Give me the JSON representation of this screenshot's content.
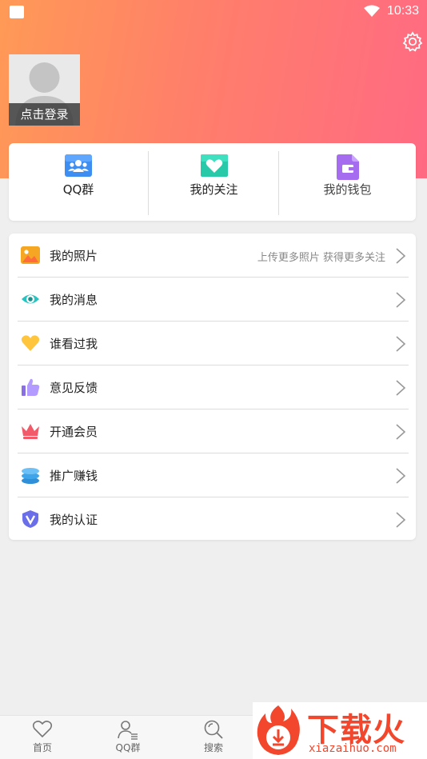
{
  "status_bar": {
    "time": "10:33"
  },
  "profile": {
    "login_label": "点击登录"
  },
  "quick_actions": [
    {
      "label": "QQ群",
      "icon": "group-icon"
    },
    {
      "label": "我的关注",
      "icon": "heart-icon"
    },
    {
      "label": "我的钱包",
      "icon": "wallet-icon"
    }
  ],
  "menu": [
    {
      "label": "我的照片",
      "hint": "上传更多照片 获得更多关注",
      "icon": "photo-icon",
      "color": "#f5a623"
    },
    {
      "label": "我的消息",
      "hint": "",
      "icon": "eye-icon",
      "color": "#27c3c0"
    },
    {
      "label": "谁看过我",
      "hint": "",
      "icon": "heart-icon",
      "color": "#ffc53d"
    },
    {
      "label": "意见反馈",
      "hint": "",
      "icon": "thumbs-up-icon",
      "color": "#9b7ff0"
    },
    {
      "label": "开通会员",
      "hint": "",
      "icon": "crown-icon",
      "color": "#f25a6a"
    },
    {
      "label": "推广赚钱",
      "hint": "",
      "icon": "coins-icon",
      "color": "#3ea5ea"
    },
    {
      "label": "我的认证",
      "hint": "",
      "icon": "shield-icon",
      "color": "#6a6ee8"
    }
  ],
  "tabbar": [
    {
      "label": "首页",
      "icon": "heart-outline-icon"
    },
    {
      "label": "QQ群",
      "icon": "user-list-icon"
    },
    {
      "label": "搜索",
      "icon": "search-icon"
    }
  ],
  "watermark": {
    "title": "下载火",
    "url": "xiazaihuo.com"
  },
  "colors": {
    "header_start": "#ff9a56",
    "header_end": "#ff6a83",
    "background": "#efefef"
  }
}
